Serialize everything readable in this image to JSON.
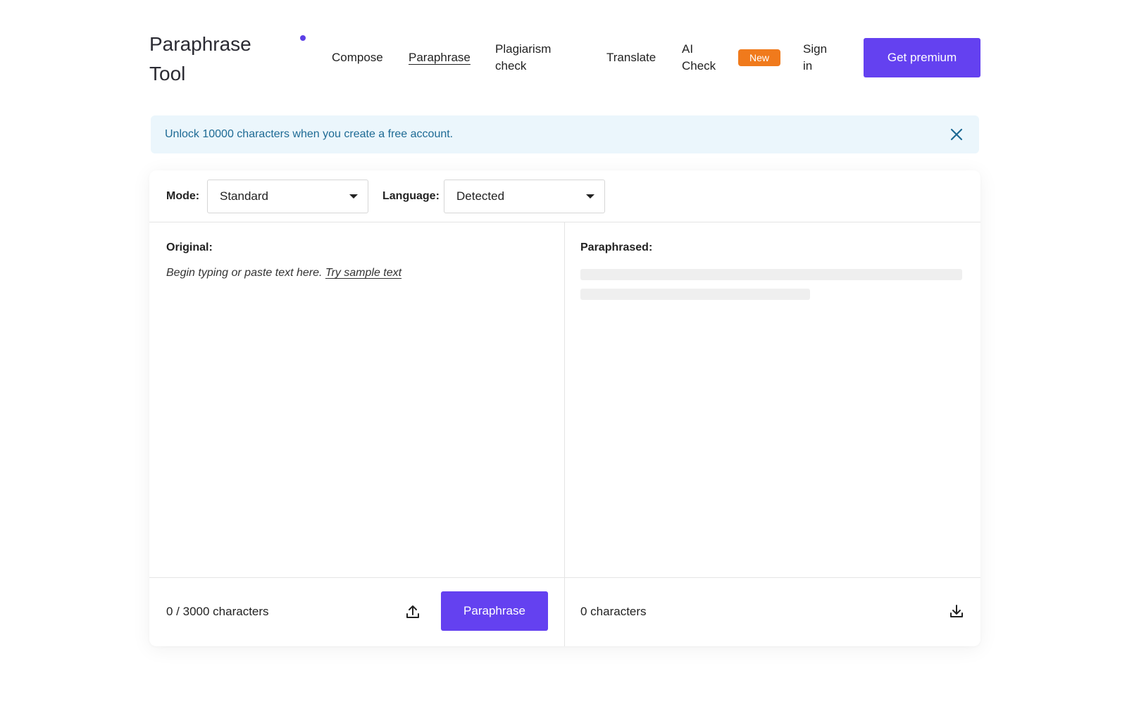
{
  "header": {
    "logo_text": "Paraphrase Tool",
    "nav": {
      "compose": "Compose",
      "paraphrase": "Paraphrase",
      "plagiarism": "Plagiarism check",
      "translate": "Translate",
      "ai_check": "AI Check",
      "new_badge": "New",
      "sign_in": "Sign in"
    },
    "premium_label": "Get premium"
  },
  "banner": {
    "text": "Unlock 10000 characters when you create a free account."
  },
  "toolbar": {
    "mode_label": "Mode:",
    "mode_value": "Standard",
    "language_label": "Language:",
    "language_value": "Detected"
  },
  "original": {
    "label": "Original:",
    "placeholder": "Begin typing or paste text here.",
    "sample_link": "Try sample text",
    "char_count": "0 / 3000 characters",
    "paraphrase_button": "Paraphrase"
  },
  "paraphrased": {
    "label": "Paraphrased:",
    "char_count": "0 characters"
  },
  "colors": {
    "accent": "#6441f0",
    "badge": "#f07a1c",
    "banner_bg": "#ebf6fc",
    "banner_text": "#1d6a94"
  },
  "icons": {
    "banner_close": "close-icon",
    "upload": "upload-icon",
    "download": "download-icon",
    "dropdown": "caret-down-icon"
  }
}
